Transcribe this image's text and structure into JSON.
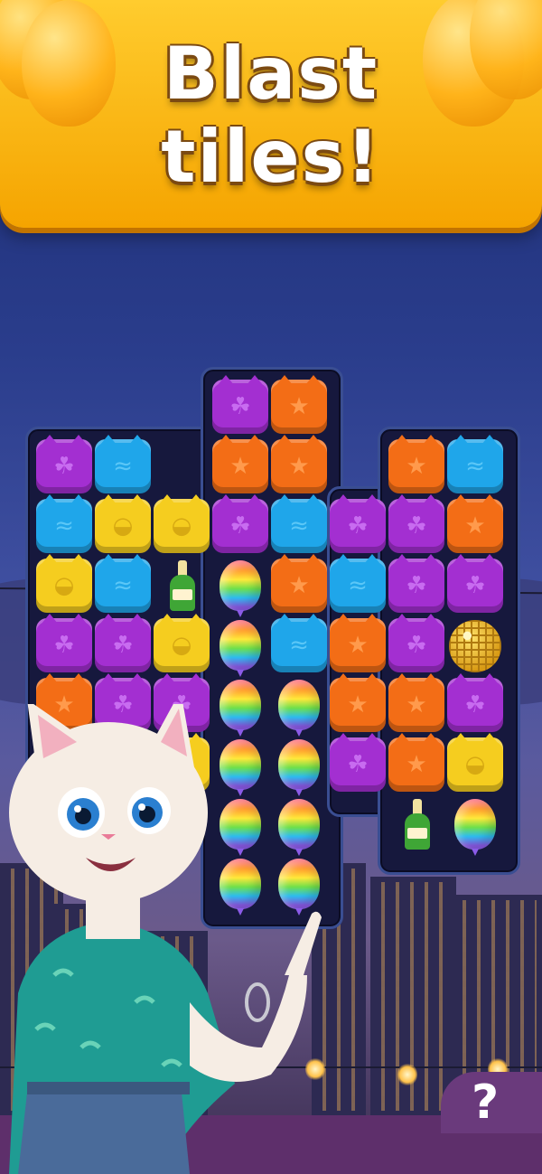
{
  "banner": {
    "line1": "Blast",
    "line2": "tiles!"
  },
  "help_button": {
    "label": "?"
  },
  "board": {
    "columns": 8,
    "rows": [
      [
        "",
        "",
        "",
        "purple",
        "orange",
        "",
        "",
        ""
      ],
      [
        "purple",
        "blue",
        "",
        "orange",
        "orange",
        "",
        "orange",
        "blue"
      ],
      [
        "blue",
        "yellow",
        "yellow",
        "purple",
        "blue",
        "purple",
        "purple",
        "orange"
      ],
      [
        "yellow",
        "blue",
        "bottle",
        "balloon",
        "orange",
        "blue",
        "purple",
        "purple"
      ],
      [
        "purple",
        "purple",
        "yellow",
        "balloon",
        "blue",
        "orange",
        "purple",
        "disco"
      ],
      [
        "orange",
        "purple",
        "purple",
        "balloon",
        "balloon",
        "orange",
        "orange",
        "purple"
      ],
      [
        "yellow",
        "blue",
        "yellow",
        "balloon",
        "balloon",
        "purple",
        "orange",
        "yellow"
      ],
      [
        "",
        "",
        "",
        "balloon",
        "balloon",
        "",
        "bottle",
        "balloon"
      ],
      [
        "",
        "",
        "",
        "balloon",
        "balloon",
        "",
        "",
        ""
      ]
    ]
  },
  "tile_icons": {
    "purple": "paw-icon",
    "blue": "fish-icon",
    "orange": "star-icon",
    "yellow": "mouse-icon"
  },
  "colors": {
    "banner": "#f5a400",
    "purple": "#a32fd1",
    "blue": "#1fa6ea",
    "orange": "#f36d16",
    "yellow": "#f5cd1f"
  }
}
